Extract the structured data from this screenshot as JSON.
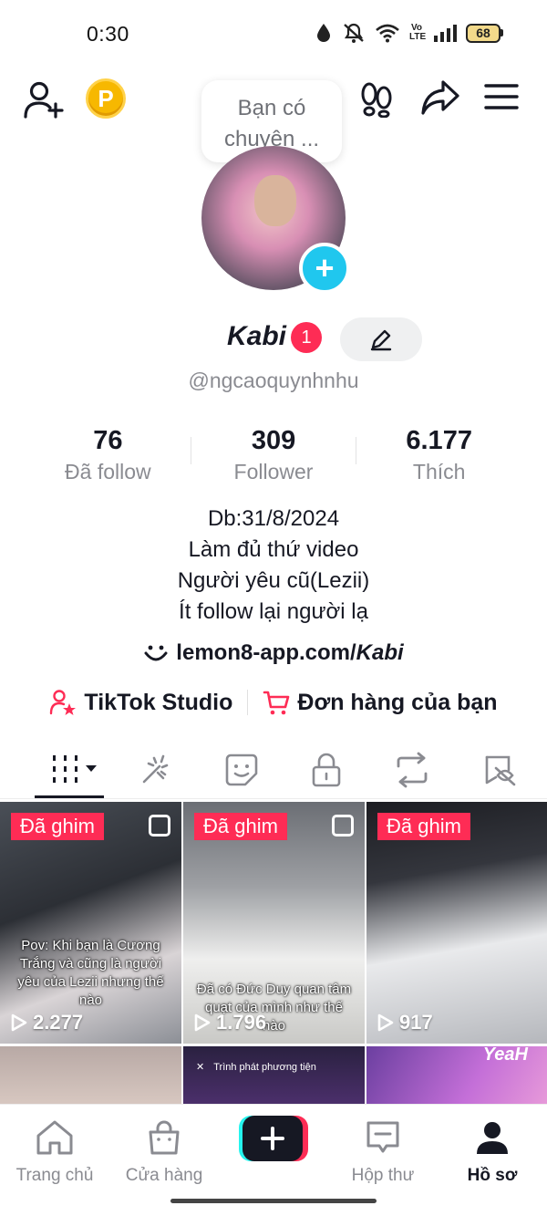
{
  "status_bar": {
    "time": "0:30",
    "network_label": "Vo LTE",
    "battery": "68",
    "icons": [
      "data-saver-icon",
      "mute-icon",
      "wifi-icon",
      "volte-icon",
      "signal-icon",
      "battery-icon"
    ]
  },
  "header": {
    "icons": [
      "add-friend-icon",
      "coin-icon",
      "footprints-icon",
      "share-icon",
      "menu-icon"
    ],
    "coin_letter": "P"
  },
  "profile": {
    "note_bubble": "Bạn có chuyện ...",
    "nickname": "Kabi",
    "notification_count": "1",
    "username": "@ngcaoquynhnhu"
  },
  "stats": [
    {
      "value": "76",
      "label": "Đã follow"
    },
    {
      "value": "309",
      "label": "Follower"
    },
    {
      "value": "6.177",
      "label": "Thích"
    }
  ],
  "bio": {
    "lines": [
      "Db:31/8/2024",
      "Làm đủ thứ video",
      "Người yêu cũ(Lezii)",
      "Ít follow lại người lạ"
    ],
    "link_prefix": "lemon8-app.com/",
    "link_suffix": "Kabi"
  },
  "quick_links": {
    "studio": "TikTok Studio",
    "orders": "Đơn hàng của bạn"
  },
  "tabs": [
    "videos-grid-icon",
    "reposts-icon",
    "favorites-icon",
    "private-icon",
    "repost-arrows-icon",
    "liked-icon"
  ],
  "videos": [
    {
      "pinned": "Đã ghim",
      "views": "2.277",
      "caption": "Pov: Khi bạn là Cương Trắng và cũng là người yêu của Lezii nhưng thế nào"
    },
    {
      "pinned": "Đã ghim",
      "views": "1.796",
      "caption": "Đã có Đức Duy quan tâm quạt của mình như thế nào"
    },
    {
      "pinned": "Đã ghim",
      "views": "917",
      "caption": ""
    },
    {
      "pinned": "",
      "views": "",
      "caption": ""
    },
    {
      "pinned": "",
      "views": "",
      "caption": "Trình phát phương tiện"
    },
    {
      "pinned": "",
      "views": "",
      "caption": "YeaH"
    }
  ],
  "bottom_nav": {
    "home": "Trang chủ",
    "shop": "Cửa hàng",
    "inbox": "Hộp thư",
    "profile": "Hồ sơ"
  },
  "colors": {
    "accent_red": "#fe2c55",
    "accent_cyan": "#20c7ee",
    "text_primary": "#161823",
    "text_secondary": "#8a8b91"
  }
}
